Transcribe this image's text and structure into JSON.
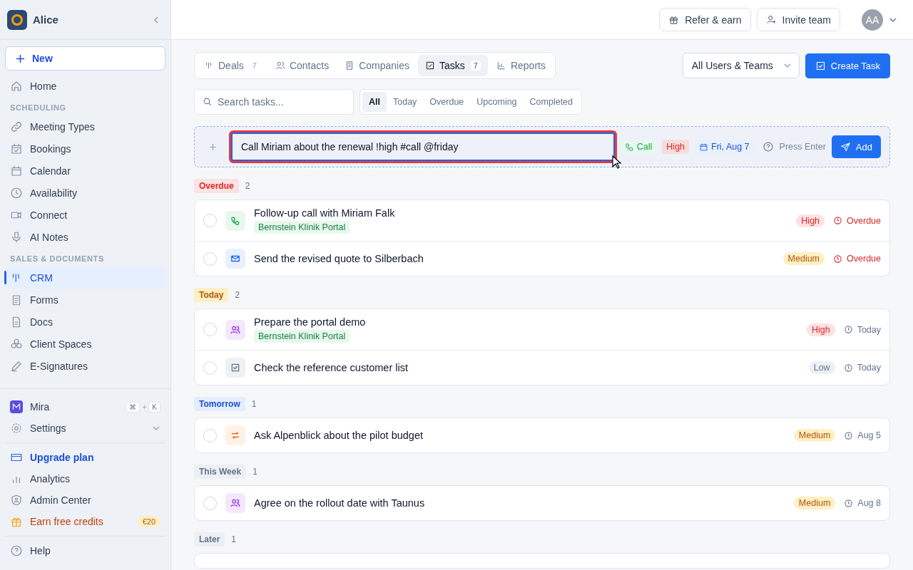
{
  "workspace": {
    "name": "Alice"
  },
  "sidebar": {
    "new_button": "New",
    "items": [
      {
        "kind": "item",
        "label": "Home",
        "selected": false
      },
      {
        "kind": "section",
        "label": "SCHEDULING"
      },
      {
        "kind": "item",
        "label": "Meeting Types",
        "selected": false
      },
      {
        "kind": "item",
        "label": "Bookings",
        "selected": false
      },
      {
        "kind": "item",
        "label": "Calendar",
        "selected": false
      },
      {
        "kind": "item",
        "label": "Availability",
        "selected": false
      },
      {
        "kind": "item",
        "label": "Connect",
        "selected": false
      },
      {
        "kind": "item",
        "label": "AI Notes",
        "selected": false
      },
      {
        "kind": "section",
        "label": "SALES & DOCUMENTS"
      },
      {
        "kind": "item",
        "label": "CRM",
        "selected": true
      },
      {
        "kind": "item",
        "label": "Forms",
        "selected": false
      },
      {
        "kind": "item",
        "label": "Docs",
        "selected": false
      },
      {
        "kind": "item",
        "label": "Client Spaces",
        "selected": false
      },
      {
        "kind": "item",
        "label": "E-Signatures",
        "selected": false
      }
    ],
    "assistant": {
      "label": "Mira",
      "keys": [
        "⌘",
        "+",
        "K"
      ]
    },
    "settings": {
      "label": "Settings"
    },
    "bottom_items": [
      {
        "kind": "upgrade",
        "label": "Upgrade plan"
      },
      {
        "kind": "plain",
        "label": "Analytics"
      },
      {
        "kind": "plain",
        "label": "Admin Center"
      },
      {
        "kind": "credits",
        "label": "Earn free credits",
        "badge": "€20"
      }
    ],
    "help": "Help"
  },
  "header": {
    "buttons": [
      "Refer & earn",
      "Invite team"
    ],
    "avatar": "AA"
  },
  "tabs": [
    {
      "label": "Deals",
      "count": "7",
      "selected": false
    },
    {
      "label": "Contacts",
      "selected": false
    },
    {
      "label": "Companies",
      "selected": false
    },
    {
      "label": "Tasks",
      "count": "7",
      "selected": true
    },
    {
      "label": "Reports",
      "selected": false
    }
  ],
  "owner_filter": "All Users & Teams",
  "create_button": "Create Task",
  "search": {
    "placeholder": "Search tasks..."
  },
  "filters": [
    {
      "label": "All",
      "selected": true
    },
    {
      "label": "Today",
      "selected": false
    },
    {
      "label": "Overdue",
      "selected": false
    },
    {
      "label": "Upcoming",
      "selected": false
    },
    {
      "label": "Completed",
      "selected": false
    }
  ],
  "quick_add": {
    "value": "Call Miriam about the renewal !high #call @friday",
    "focused": true,
    "type_chip": "Call",
    "priority_chip": "High",
    "date_chip": "Fri, Aug 7",
    "hint": "Press Enter",
    "button": "Add"
  },
  "groups": [
    {
      "label": "Overdue",
      "kind": "overdue",
      "count": "2",
      "tasks": [
        {
          "title": "Follow-up call with Miriam Falk",
          "kind": "call",
          "tag": "Bernstein Klinik Portal",
          "priority": {
            "label": "High",
            "kind": "high"
          },
          "due": "Overdue",
          "overdue": true,
          "done": false
        },
        {
          "title": "Send the revised quote to Silberbach",
          "kind": "email",
          "priority": {
            "label": "Medium",
            "kind": "medium"
          },
          "due": "Overdue",
          "overdue": true,
          "done": false
        }
      ]
    },
    {
      "label": "Today",
      "kind": "today",
      "count": "2",
      "tasks": [
        {
          "title": "Prepare the portal demo",
          "kind": "meeting",
          "tag": "Bernstein Klinik Portal",
          "priority": {
            "label": "High",
            "kind": "high"
          },
          "due": "Today",
          "overdue": false,
          "done": false
        },
        {
          "title": "Check the reference customer list",
          "kind": "todo",
          "priority": {
            "label": "Low",
            "kind": "low"
          },
          "due": "Today",
          "overdue": false,
          "done": false
        }
      ]
    },
    {
      "label": "Tomorrow",
      "kind": "tomorrow",
      "count": "1",
      "tasks": [
        {
          "title": "Ask Alpenblick about the pilot budget",
          "kind": "followup",
          "priority": {
            "label": "Medium",
            "kind": "medium"
          },
          "due": "Aug 5",
          "overdue": false,
          "done": false
        }
      ]
    },
    {
      "label": "This Week",
      "kind": "later",
      "count": "1",
      "tasks": [
        {
          "title": "Agree on the rollout date with Taunus",
          "kind": "meeting",
          "priority": {
            "label": "Medium",
            "kind": "medium"
          },
          "due": "Aug 8",
          "overdue": false,
          "done": false
        }
      ]
    },
    {
      "label": "Later",
      "kind": "later",
      "count": "1"
    }
  ]
}
